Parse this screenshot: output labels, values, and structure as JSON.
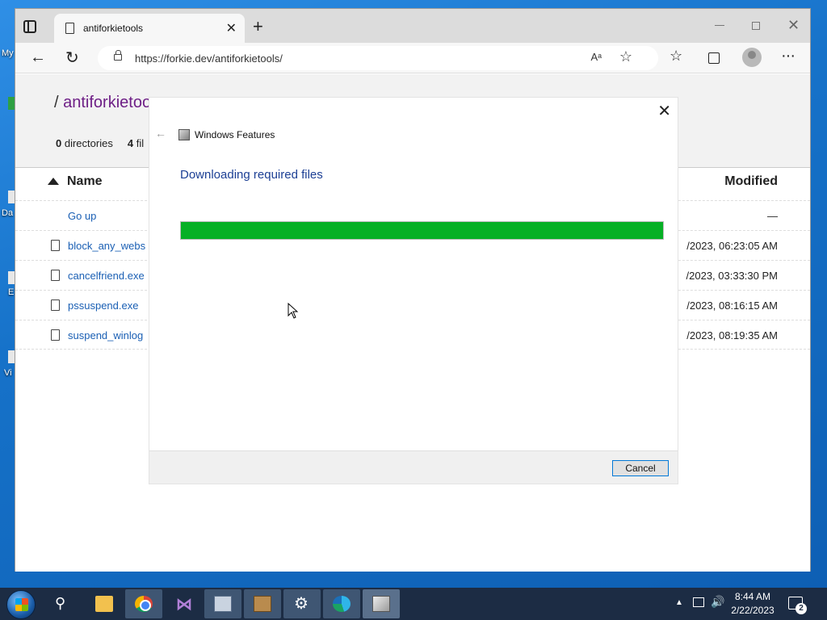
{
  "desktop": {
    "icon_labels": [
      "My",
      "Da",
      "E",
      "Vi"
    ]
  },
  "browser": {
    "tab_title": "antiforkietools",
    "url": "https://forkie.dev/antiforkietools/",
    "readaloud_glyph": "Aᵃ"
  },
  "page": {
    "breadcrumb_sep": "/",
    "breadcrumb_link": "antiforkietoo",
    "counts": {
      "dirs_num": "0",
      "dirs_label": "directories",
      "files_num": "4",
      "files_label": "fil"
    },
    "columns": {
      "name": "Name",
      "modified": "Modified"
    },
    "rows": [
      {
        "name": "Go up",
        "modified": "—",
        "icon": false
      },
      {
        "name": "block_any_webs",
        "modified": "/2023, 06:23:05 AM",
        "icon": true
      },
      {
        "name": "cancelfriend.exe",
        "modified": "/2023, 03:33:30 PM",
        "icon": true
      },
      {
        "name": "pssuspend.exe",
        "modified": "/2023, 08:16:15 AM",
        "icon": true
      },
      {
        "name": "suspend_winlog",
        "modified": "/2023, 08:19:35 AM",
        "icon": true
      }
    ]
  },
  "dialog": {
    "title": "Windows Features",
    "heading": "Downloading required files",
    "progress_fraction": 1.0,
    "progress_color": "#06b025",
    "cancel_label": "Cancel"
  },
  "taskbar": {
    "time": "8:44 AM",
    "date": "2/22/2023",
    "notification_count": "2",
    "pinned": [
      "file-explorer-icon",
      "chrome-icon",
      "visual-studio-icon",
      "keyboard-app-icon",
      "package-app-icon",
      "settings-icon",
      "edge-icon",
      "windows-features-icon"
    ]
  }
}
